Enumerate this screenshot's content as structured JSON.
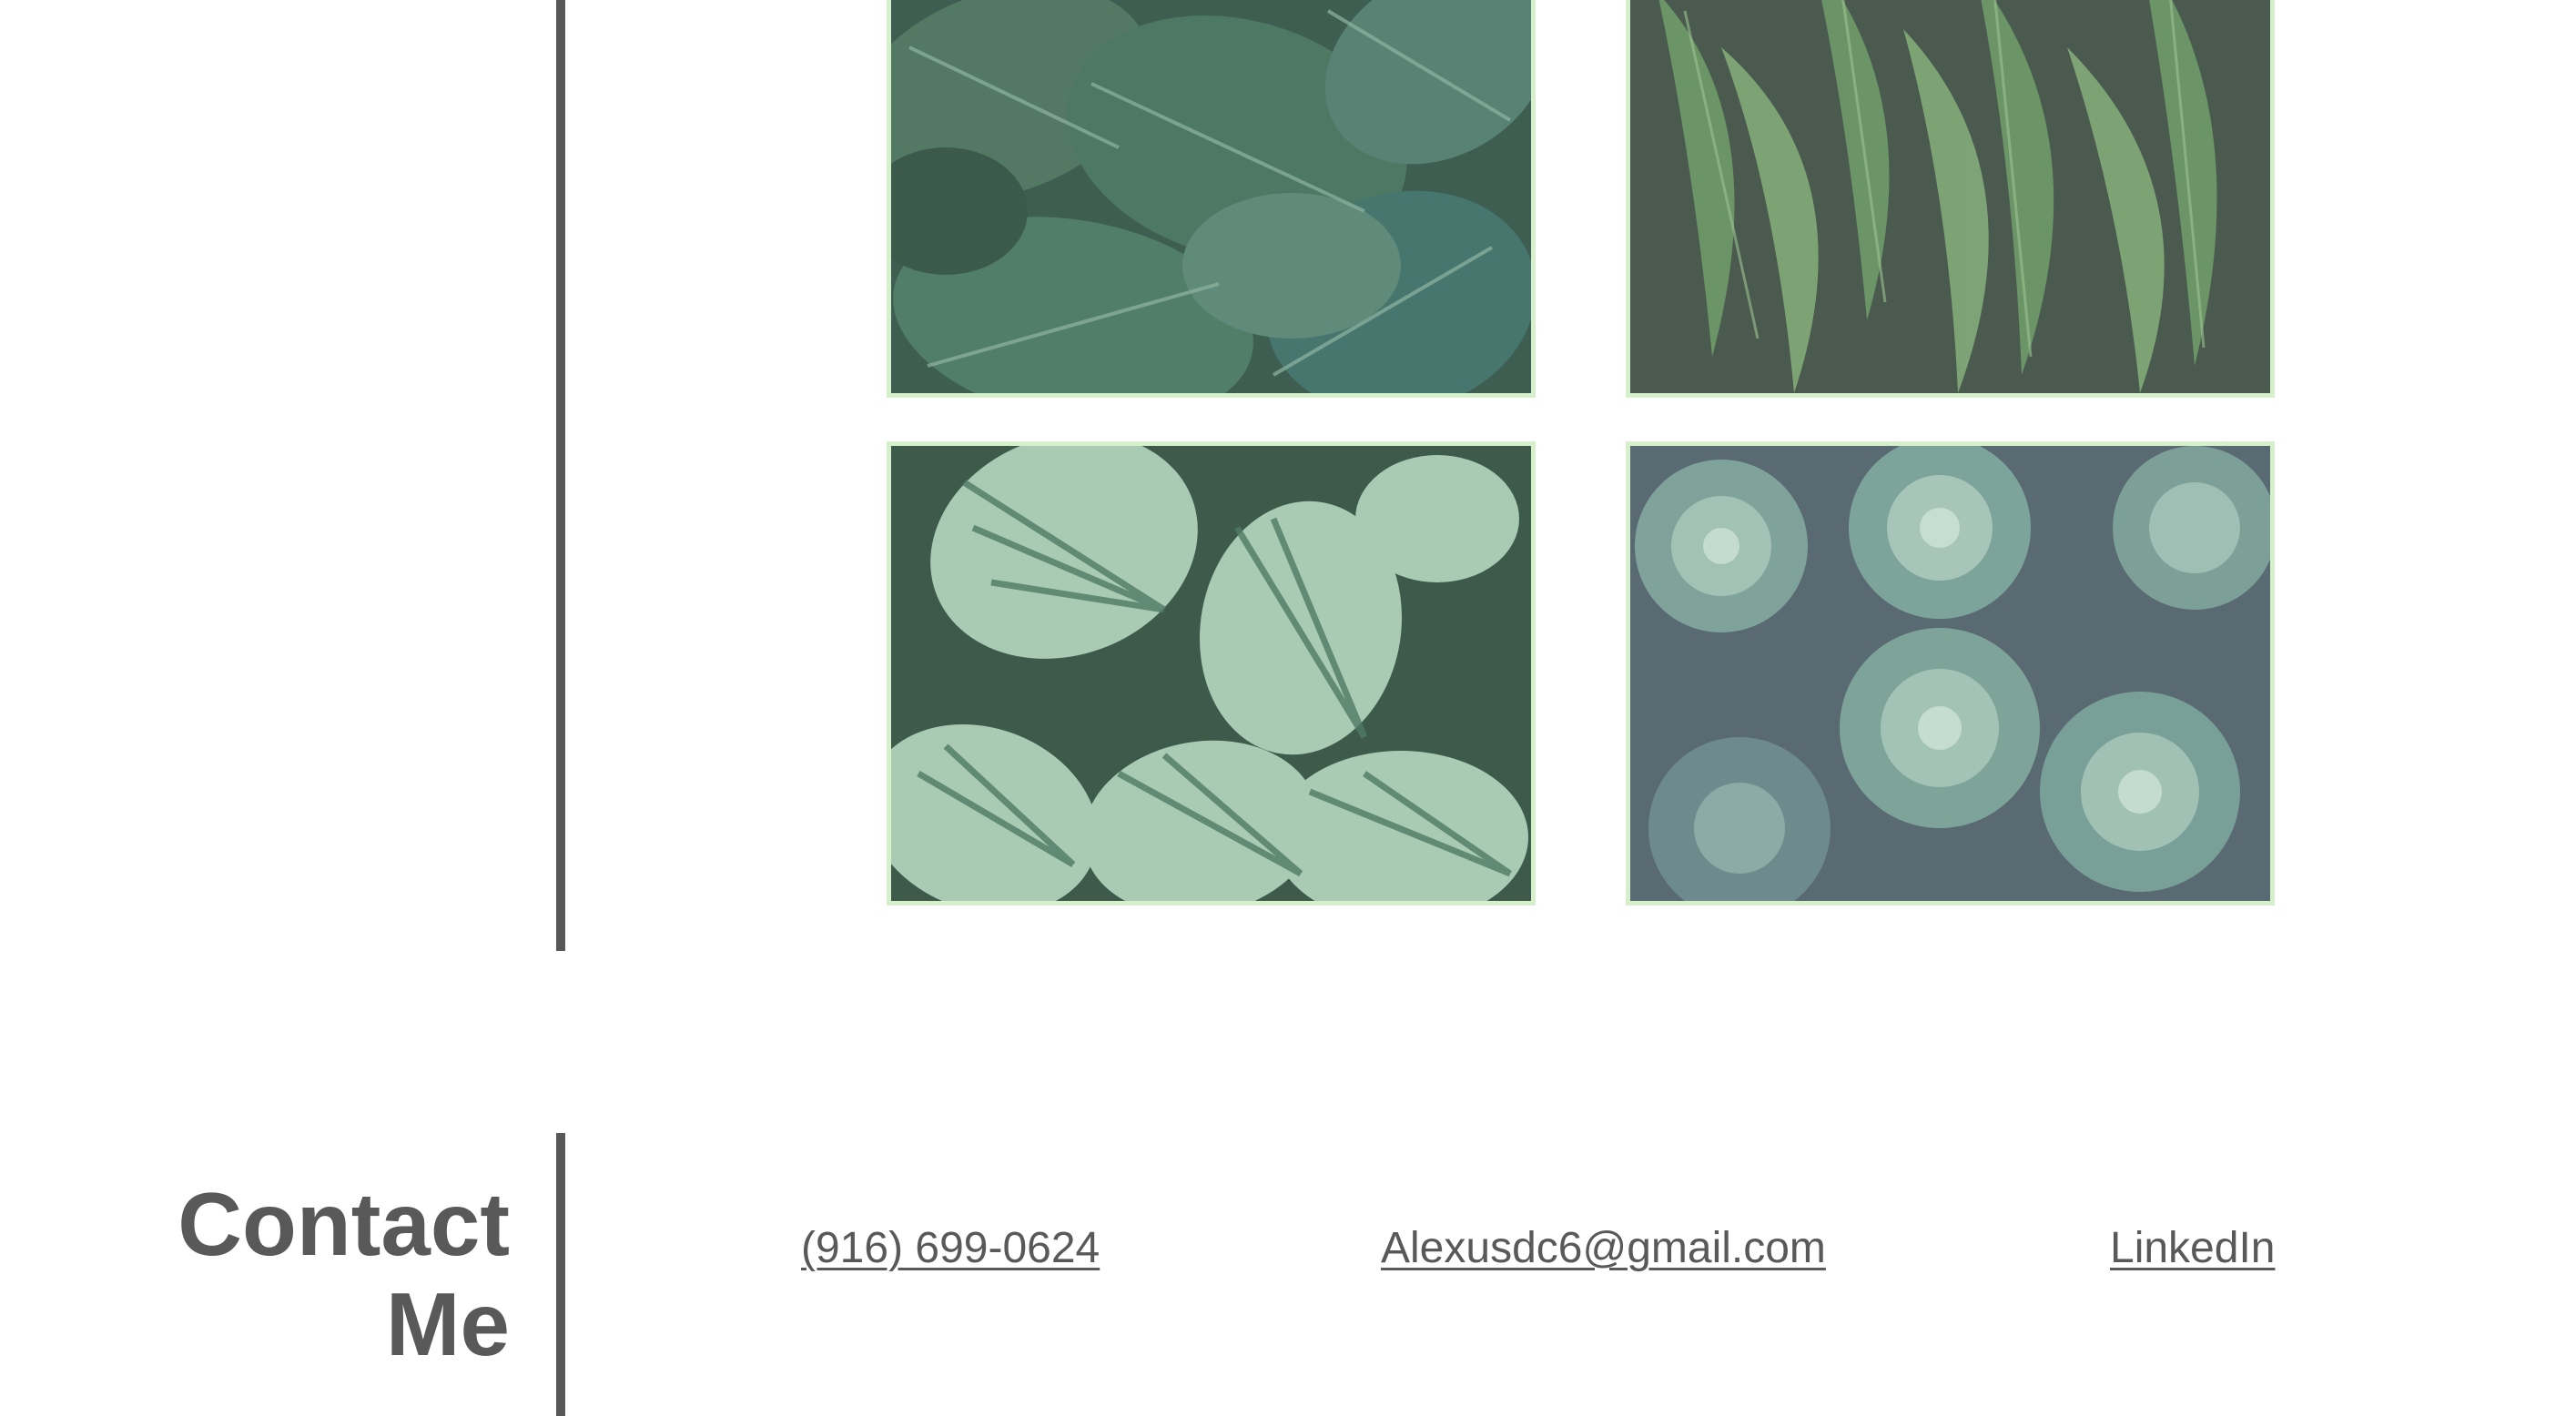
{
  "gallery": {
    "tiles": [
      {
        "name": "monstera-leaves-photo",
        "subject": "monstera-leaves"
      },
      {
        "name": "fern-fronds-photo",
        "subject": "fern-fronds"
      },
      {
        "name": "calathea-leaves-photo",
        "subject": "striped-calathea-leaves"
      },
      {
        "name": "succulents-photo",
        "subject": "echeveria-succulents"
      }
    ],
    "border_color": "#d6f0cc"
  },
  "contact": {
    "heading_line1": "Contact",
    "heading_line2": "Me",
    "phone": "(916) 699-0624",
    "email": "Alexusdc6@gmail.com",
    "linkedin": "LinkedIn"
  },
  "colors": {
    "text": "#595959",
    "divider": "#595959",
    "background": "#ffffff"
  }
}
